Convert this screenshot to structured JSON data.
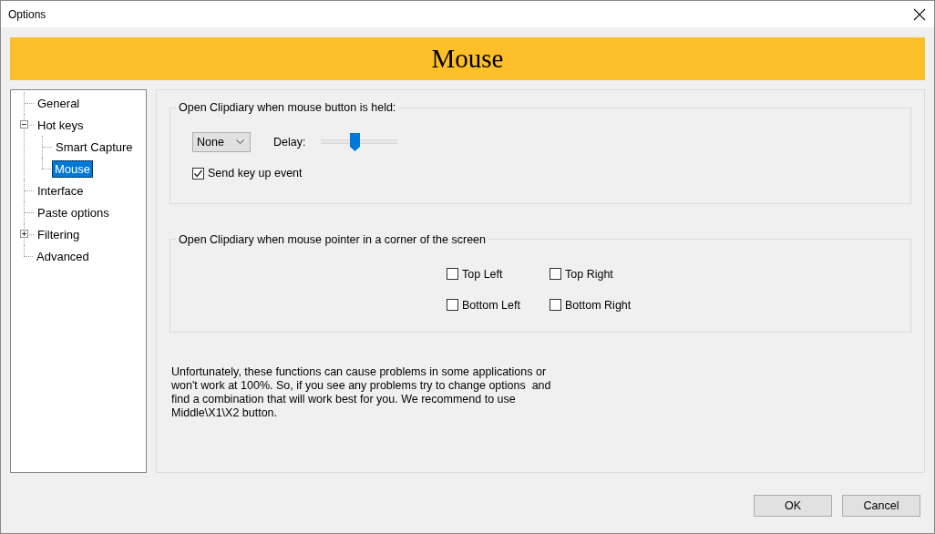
{
  "window": {
    "title": "Options"
  },
  "header": {
    "title": "Mouse"
  },
  "tree": [
    {
      "label": "General",
      "selected": false
    },
    {
      "label": "Hot keys",
      "selected": false,
      "expanded": true,
      "children": [
        {
          "label": "Smart Capture",
          "selected": false
        },
        {
          "label": "Mouse",
          "selected": true
        }
      ]
    },
    {
      "label": "Interface",
      "selected": false
    },
    {
      "label": "Paste options",
      "selected": false
    },
    {
      "label": "Filtering",
      "selected": false,
      "expanded": false
    },
    {
      "label": "Advanced",
      "selected": false
    }
  ],
  "mouse_button_group": {
    "title": "Open Clipdiary when mouse button is held:",
    "dropdown": {
      "value": "None"
    },
    "delay": {
      "label": "Delay:",
      "level": 0.44
    },
    "send_key_up": {
      "label": "Send key up event",
      "checked": true
    }
  },
  "corner_group": {
    "title": "Open Clipdiary when mouse pointer in a corner of the screen",
    "corners": [
      {
        "label": "Top Left",
        "checked": false
      },
      {
        "label": "Top Right",
        "checked": false
      },
      {
        "label": "Bottom Left",
        "checked": false
      },
      {
        "label": "Bottom Right",
        "checked": false
      }
    ]
  },
  "note": "Unfortunately, these functions can cause problems in some applications or won't work at 100%. So, if you see any problems try to change options  and find a combination that will work best for you. We recommend to use Middle\\X1\\X2 button.",
  "buttons": [
    "OK",
    "Cancel"
  ]
}
